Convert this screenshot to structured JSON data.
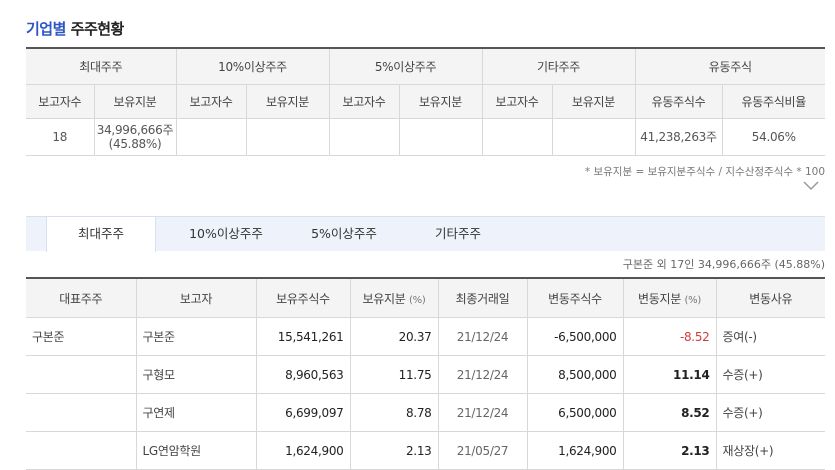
{
  "title": {
    "part1": "기업별",
    "part2": "주주현황"
  },
  "summary": {
    "groups": [
      "최대주주",
      "10%이상주주",
      "5%이상주주",
      "기타주주",
      "유동주식"
    ],
    "subheaders": [
      "보고자수",
      "보유지분",
      "보고자수",
      "보유지분",
      "보고자수",
      "보유지분",
      "보고자수",
      "보유지분",
      "유동주식수",
      "유동주식비율"
    ],
    "row": {
      "c1": "18",
      "c2a": "34,996,666주",
      "c2b": "(45.88%)",
      "c9": "41,238,263주",
      "c10": "54.06%"
    },
    "note": "* 보유지분 = 보유지분주식수 / 지수산정주식수 * 100"
  },
  "tabs": [
    "최대주주",
    "10%이상주주",
    "5%이상주주",
    "기타주주"
  ],
  "subinfo": "구본준 외 17인 34,996,666주 (45.88%)",
  "detail": {
    "headers": {
      "h1": "대표주주",
      "h2": "보고자",
      "h3": "보유주식수",
      "h4": "보유지분",
      "h5": "최종거래일",
      "h6": "변동주식수",
      "h7": "변동지분",
      "h8": "변동사유",
      "unit": "(%)"
    },
    "rows": [
      {
        "rep": "구본준",
        "name": "구본준",
        "shares": "15,541,261",
        "pct": "20.37",
        "date": "21/12/24",
        "chg": "-6,500,000",
        "chgpct": "-8.52",
        "reason": "증여(-)"
      },
      {
        "rep": "",
        "name": "구형모",
        "shares": "8,960,563",
        "pct": "11.75",
        "date": "21/12/24",
        "chg": "8,500,000",
        "chgpct": "11.14",
        "reason": "수증(+)"
      },
      {
        "rep": "",
        "name": "구연제",
        "shares": "6,699,097",
        "pct": "8.78",
        "date": "21/12/24",
        "chg": "6,500,000",
        "chgpct": "8.52",
        "reason": "수증(+)"
      },
      {
        "rep": "",
        "name": "LG연암학원",
        "shares": "1,624,900",
        "pct": "2.13",
        "date": "21/05/27",
        "chg": "1,624,900",
        "chgpct": "2.13",
        "reason": "재상장(+)"
      }
    ]
  }
}
